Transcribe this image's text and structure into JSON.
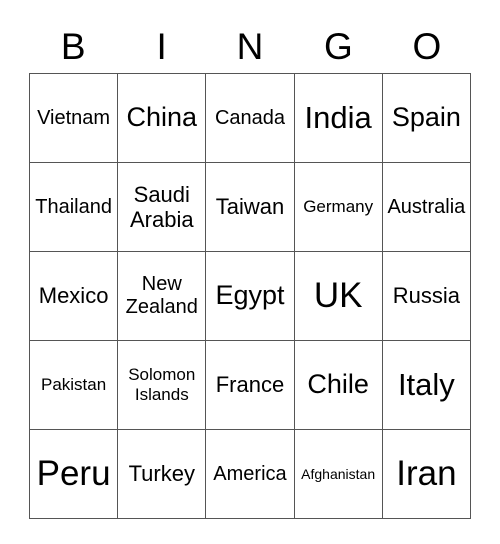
{
  "header": [
    "B",
    "I",
    "N",
    "G",
    "O"
  ],
  "rows": [
    [
      "Vietnam",
      "China",
      "Canada",
      "India",
      "Spain"
    ],
    [
      "Thailand",
      "Saudi Arabia",
      "Taiwan",
      "Germany",
      "Australia"
    ],
    [
      "Mexico",
      "New Zealand",
      "Egypt",
      "UK",
      "Russia"
    ],
    [
      "Pakistan",
      "Solomon Islands",
      "France",
      "Chile",
      "Italy"
    ],
    [
      "Peru",
      "Turkey",
      "America",
      "Afghanistan",
      "Iran"
    ]
  ]
}
